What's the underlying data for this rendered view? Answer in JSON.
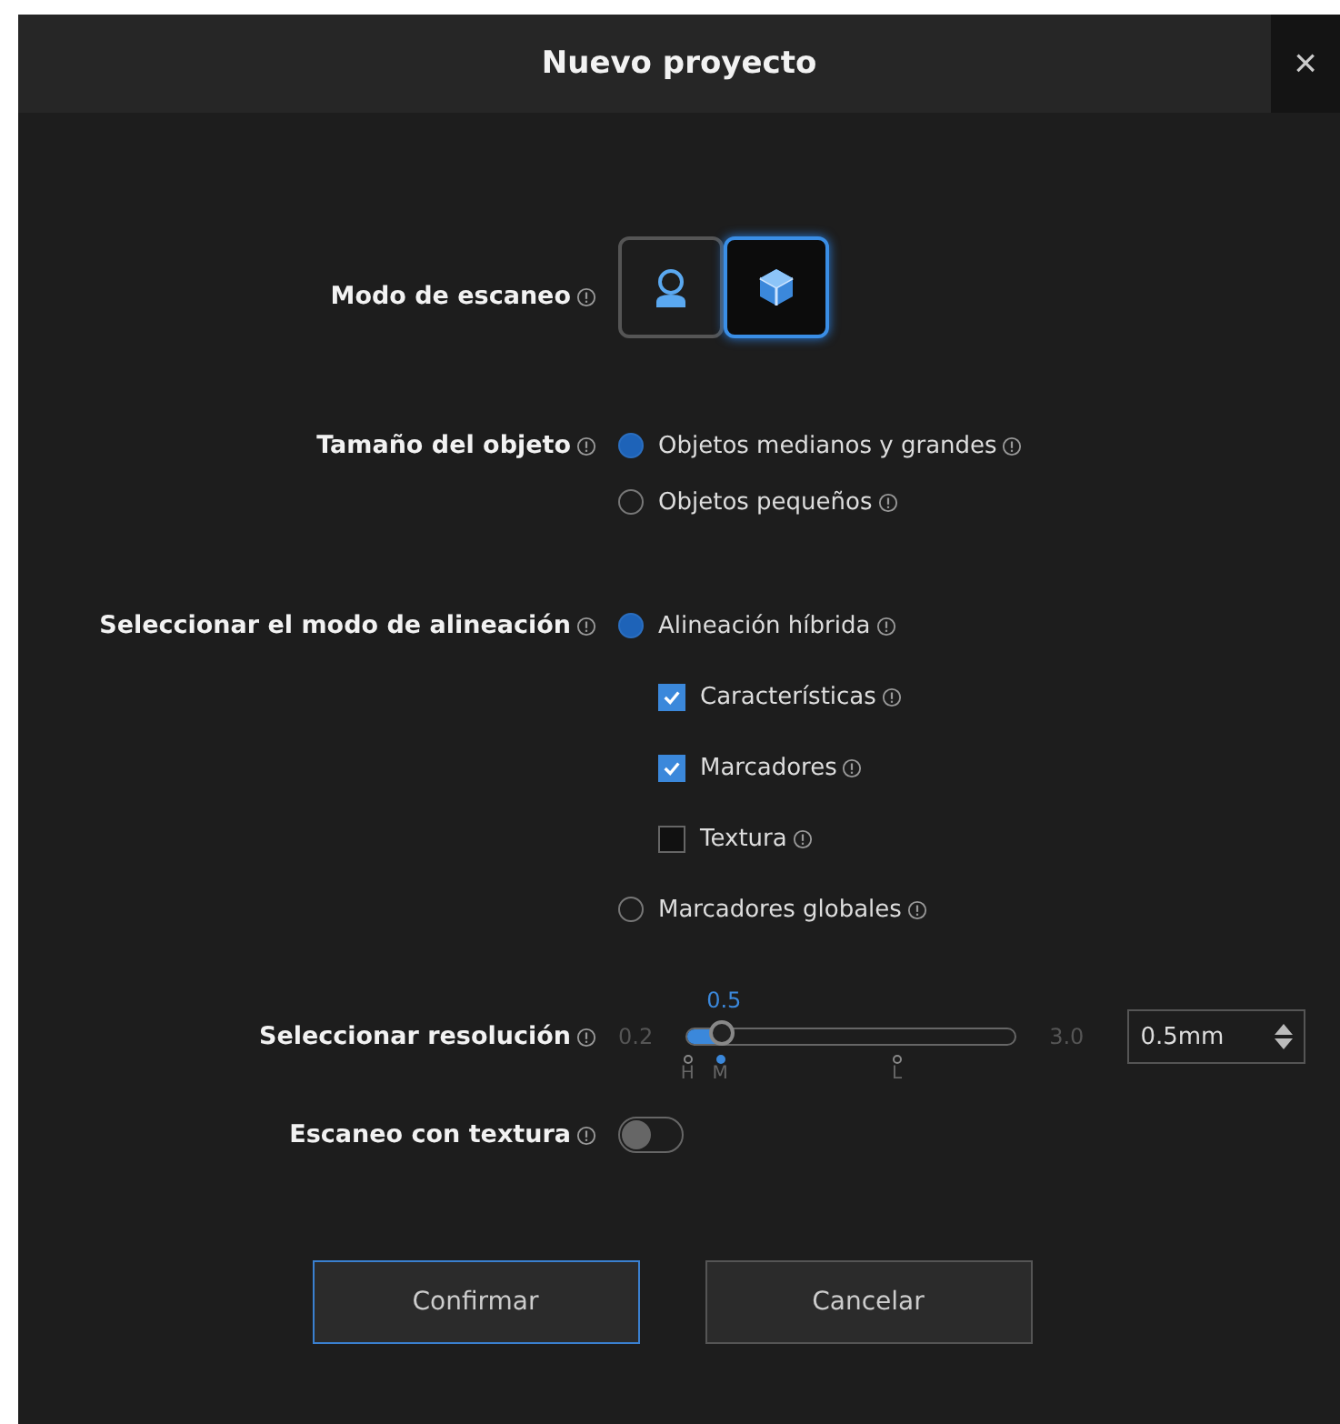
{
  "window": {
    "title": "Nuevo proyecto",
    "close": "×"
  },
  "scan_mode": {
    "label": "Modo de escaneo",
    "options": [
      {
        "kind": "person",
        "selected": false
      },
      {
        "kind": "object",
        "selected": true
      }
    ]
  },
  "object_size": {
    "label": "Tamaño del objeto",
    "options": [
      {
        "label": "Objetos medianos y grandes",
        "selected": true
      },
      {
        "label": "Objetos pequeños",
        "selected": false
      }
    ]
  },
  "alignment": {
    "label": "Seleccionar el modo de alineación",
    "options": [
      {
        "label": "Alineación híbrida",
        "selected": true,
        "children": [
          {
            "label": "Características",
            "checked": true
          },
          {
            "label": "Marcadores",
            "checked": true
          },
          {
            "label": "Textura",
            "checked": false
          }
        ]
      },
      {
        "label": "Marcadores globales",
        "selected": false
      }
    ]
  },
  "resolution": {
    "label": "Seleccionar resolución",
    "min": "0.2",
    "max": "3.0",
    "current": "0.5",
    "level": 0.107,
    "value": "0.5mm",
    "ticks": [
      {
        "label": "H",
        "selected": false
      },
      {
        "label": "M",
        "selected": true
      },
      {
        "label": "L",
        "selected": false
      }
    ]
  },
  "texture_scan": {
    "label": "Escaneo con textura",
    "on": false
  },
  "buttons": [
    {
      "label": "Confirmar",
      "kind": "primary"
    },
    {
      "label": "Cancelar",
      "kind": "secondary"
    }
  ]
}
